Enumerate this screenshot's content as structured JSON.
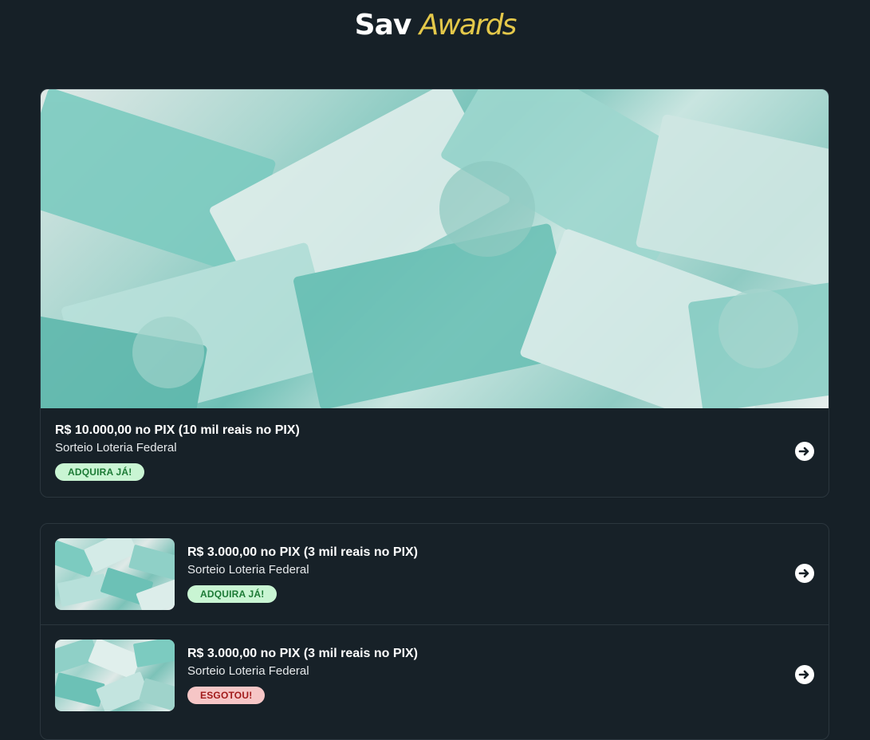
{
  "header": {
    "logo_brand": "Sav",
    "logo_sub": "Awards"
  },
  "featured": {
    "title": "R$ 10.000,00 no PIX (10 mil reais no PIX)",
    "subtitle": "Sorteio Loteria Federal",
    "badge": "ADQUIRA JÁ!",
    "image": "banknotes-100-reais"
  },
  "raffles": [
    {
      "title": "R$ 3.000,00 no PIX (3 mil reais no PIX)",
      "subtitle": "Sorteio Loteria Federal",
      "badge": "ADQUIRA JÁ!",
      "status": "available",
      "image": "banknotes-100-reais"
    },
    {
      "title": "R$ 3.000,00 no PIX (3 mil reais no PIX)",
      "subtitle": "Sorteio Loteria Federal",
      "badge": "ESGOTOU!",
      "status": "sold-out",
      "image": "banknotes-100-reais"
    }
  ],
  "icons": {
    "open": "arrow-right-circle-icon"
  },
  "colors": {
    "background": "#162027",
    "accent": "#e4c84a",
    "badge_available": "#c9f5d3",
    "badge_soldout": "#f6c6c6"
  }
}
